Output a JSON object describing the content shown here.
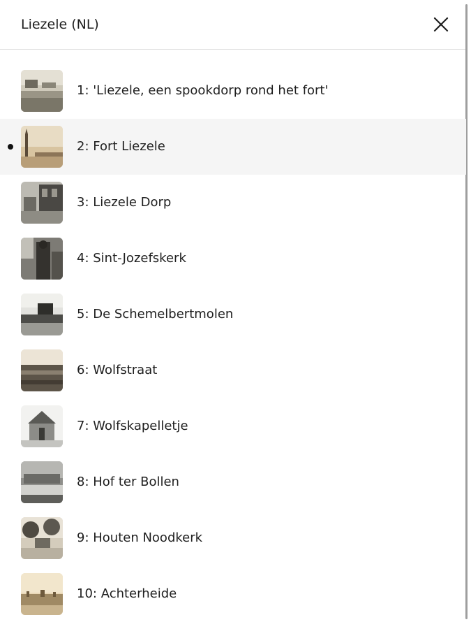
{
  "header": {
    "title": "Liezele (NL)",
    "close_icon": "close-icon"
  },
  "active_index": 1,
  "items": [
    {
      "label": "1: 'Liezele, een spookdorp rond het fort'",
      "thumb": "fort-photo"
    },
    {
      "label": "2: Fort Liezele",
      "thumb": "tower-photo"
    },
    {
      "label": "3: Liezele Dorp",
      "thumb": "village-photo"
    },
    {
      "label": "4: Sint-Jozefskerk",
      "thumb": "church-photo"
    },
    {
      "label": "5: De Schemelbertmolen",
      "thumb": "mill-photo"
    },
    {
      "label": "6: Wolfstraat",
      "thumb": "street-photo"
    },
    {
      "label": "7: Wolfskapelletje",
      "thumb": "chapel-photo"
    },
    {
      "label": "8: Hof ter Bollen",
      "thumb": "farm-photo"
    },
    {
      "label": "9: Houten Noodkerk",
      "thumb": "wooden-church-photo"
    },
    {
      "label": "10: Achterheide",
      "thumb": "heath-photo"
    }
  ]
}
